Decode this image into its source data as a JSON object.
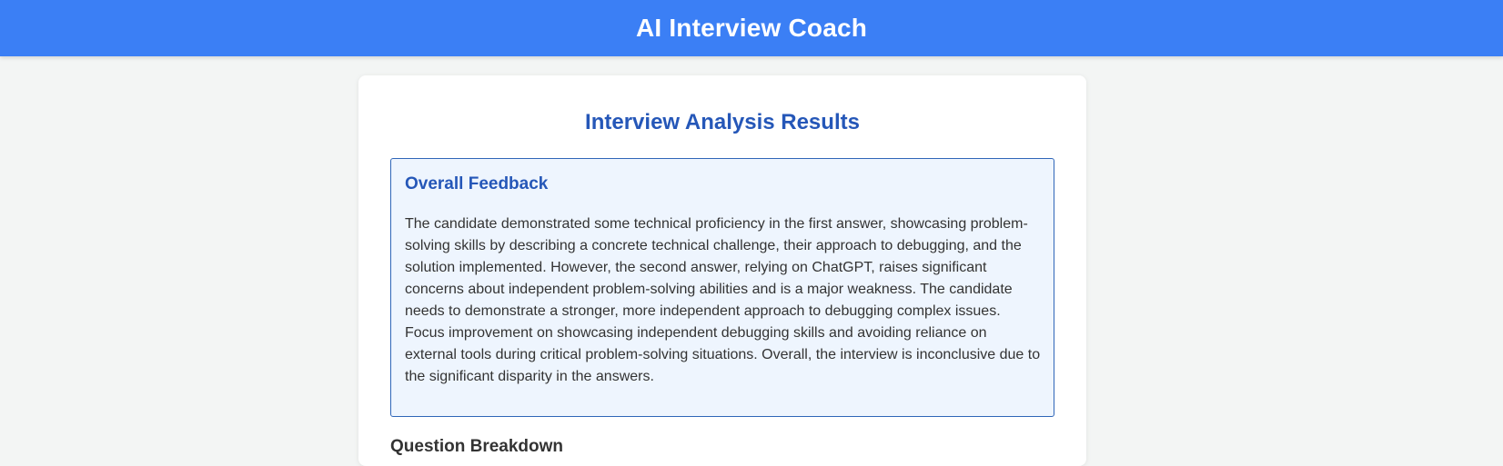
{
  "header": {
    "title": "AI Interview Coach"
  },
  "results": {
    "title": "Interview Analysis Results",
    "overall_feedback": {
      "heading": "Overall Feedback",
      "text": "The candidate demonstrated some technical proficiency in the first answer, showcasing problem-solving skills by describing a concrete technical challenge, their approach to debugging, and the solution implemented. However, the second answer, relying on ChatGPT, raises significant concerns about independent problem-solving abilities and is a major weakness. The candidate needs to demonstrate a stronger, more independent approach to debugging complex issues. Focus improvement on showcasing independent debugging skills and avoiding reliance on external tools during critical problem-solving situations. Overall, the interview is inconclusive due to the significant disparity in the answers."
    },
    "question_breakdown": {
      "heading": "Question Breakdown"
    }
  },
  "colors": {
    "header_bg": "#3b7ff5",
    "accent": "#2557b8",
    "feedback_bg": "#eef5fe",
    "page_bg": "#f3f5f4"
  }
}
